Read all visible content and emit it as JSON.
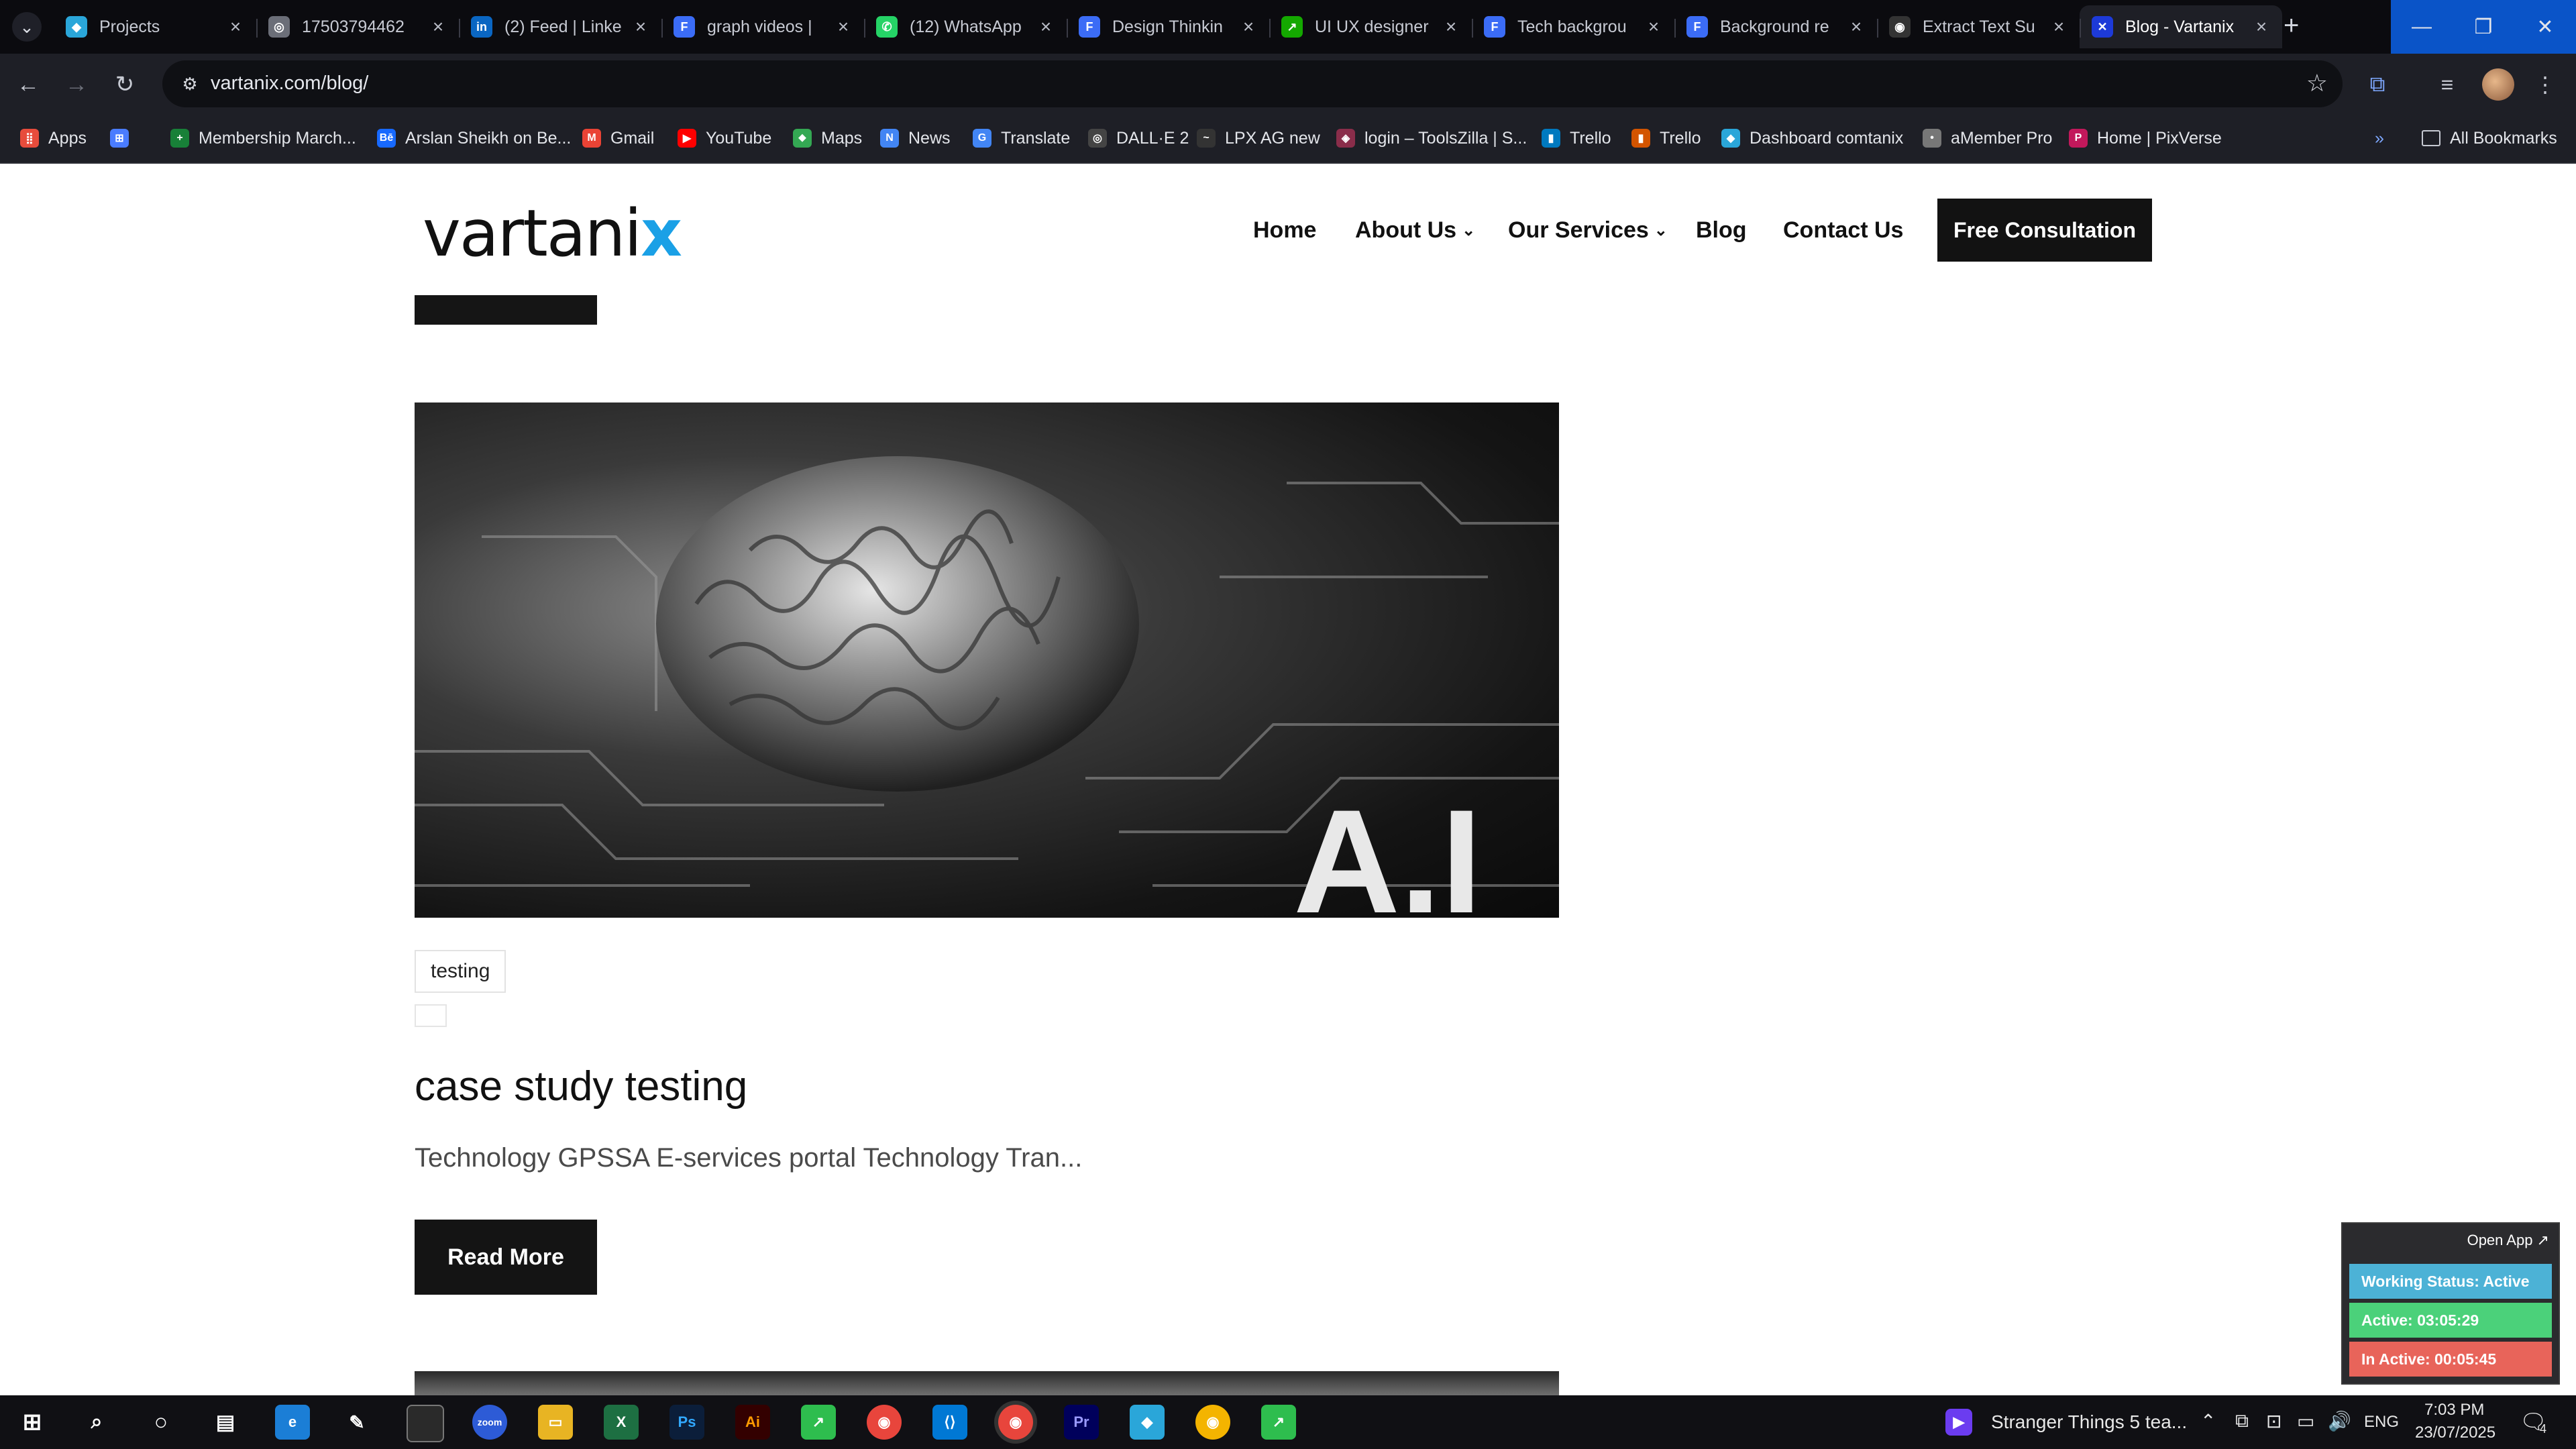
{
  "tabs": [
    {
      "title": "Projects",
      "favicon": "projects-icon",
      "color": "#2aa6d9",
      "active": false
    },
    {
      "title": "17503794462",
      "favicon": "globe-icon",
      "color": "#6b6e78",
      "active": false
    },
    {
      "title": "(2) Feed | Linke",
      "favicon": "linkedin-icon",
      "color": "#0a66c2",
      "active": false
    },
    {
      "title": "graph videos |",
      "favicon": "document-icon",
      "color": "#3b6cf6",
      "active": false
    },
    {
      "title": "(12) WhatsApp",
      "favicon": "whatsapp-icon",
      "color": "#25d366",
      "active": false
    },
    {
      "title": "Design Thinkin",
      "favicon": "document-icon",
      "color": "#3b6cf6",
      "active": false
    },
    {
      "title": "UI UX designer",
      "favicon": "upwork-icon",
      "color": "#14a800",
      "active": false
    },
    {
      "title": "Tech backgrou",
      "favicon": "document-icon",
      "color": "#3b6cf6",
      "active": false
    },
    {
      "title": "Background re",
      "favicon": "document-icon",
      "color": "#3b6cf6",
      "active": false
    },
    {
      "title": "Extract Text Su",
      "favicon": "extract-icon",
      "color": "#333333",
      "active": false
    },
    {
      "title": "Blog - Vartanix",
      "favicon": "vartanix-icon",
      "color": "#1d3ad8",
      "active": true
    }
  ],
  "url": "vartanix.com/blog/",
  "bookmarks": [
    {
      "label": "Apps",
      "icon": "apps-grid-icon",
      "color": "#e74c3c"
    },
    {
      "label": "",
      "icon": "tab-groups-icon",
      "color": "#4a7cff"
    },
    {
      "label": "Membership March...",
      "icon": "sheets-icon",
      "color": "#188038"
    },
    {
      "label": "Arslan Sheikh on Be...",
      "icon": "behance-icon",
      "color": "#1769ff"
    },
    {
      "label": "Gmail",
      "icon": "gmail-icon",
      "color": "#ea4335"
    },
    {
      "label": "YouTube",
      "icon": "youtube-icon",
      "color": "#ff0000"
    },
    {
      "label": "Maps",
      "icon": "maps-icon",
      "color": "#34a853"
    },
    {
      "label": "News",
      "icon": "news-icon",
      "color": "#4285f4"
    },
    {
      "label": "Translate",
      "icon": "translate-icon",
      "color": "#4285f4"
    },
    {
      "label": "DALL·E 2",
      "icon": "openai-icon",
      "color": "#444444"
    },
    {
      "label": "LPX AG new",
      "icon": "lpx-icon",
      "color": "#333333"
    },
    {
      "label": "login – ToolsZilla | S...",
      "icon": "toolszilla-icon",
      "color": "#8a2d4a"
    },
    {
      "label": "Trello",
      "icon": "trello-icon",
      "color": "#0079bf"
    },
    {
      "label": "Trello",
      "icon": "trello-icon",
      "color": "#d35400"
    },
    {
      "label": "Dashboard comtanix",
      "icon": "dashboard-icon",
      "color": "#2aa6d9"
    },
    {
      "label": "aMember Pro",
      "icon": "globe-icon",
      "color": "#777777"
    },
    {
      "label": "Home | PixVerse",
      "icon": "pixverse-icon",
      "color": "#c2185b"
    }
  ],
  "all_bookmarks": "All Bookmarks",
  "site": {
    "logo": "vartanix",
    "nav": [
      "Home",
      "About Us",
      "Our Services",
      "Blog",
      "Contact Us"
    ],
    "cta": "Free Consultation"
  },
  "post": {
    "tag": "testing",
    "title": "case study testing",
    "excerpt": "Technology GPSSA E-services portal Technology Tran...",
    "read_more": "Read More",
    "image_text": "A.I"
  },
  "widget": {
    "open_app": "Open App ↗",
    "status": "Working Status: Active",
    "active": "Active: 03:05:29",
    "inactive": "In Active: 00:05:45"
  },
  "taskbar": {
    "media": "Stranger Things 5 tea...",
    "lang": "ENG",
    "time": "7:03 PM",
    "date": "23/07/2025",
    "notification_count": "4"
  }
}
